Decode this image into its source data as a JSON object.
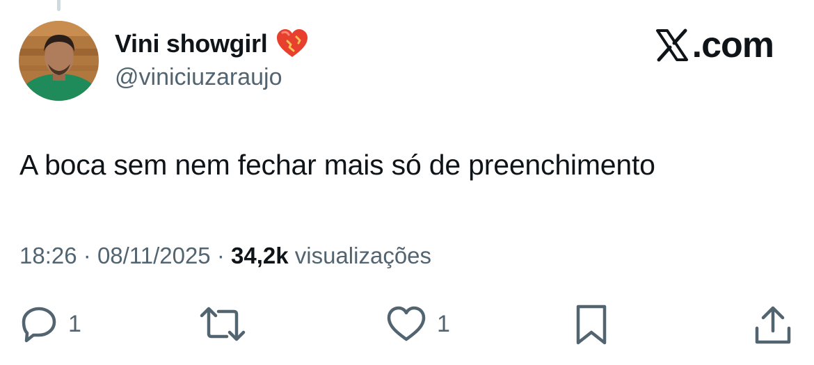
{
  "author": {
    "display_name": "Vini showgirl",
    "handle": "@viniciuzaraujo",
    "badge_icon": "mending-heart-emoji-icon"
  },
  "brand": {
    "text": ".com",
    "logo_icon": "x-logo-icon"
  },
  "tweet": {
    "text": "A boca sem nem fechar mais só de preenchimento"
  },
  "meta": {
    "time": "18:26",
    "separator": "·",
    "date": "08/11/2025",
    "views_count": "34,2k",
    "views_label": "visualizações"
  },
  "actions": {
    "reply_count": "1",
    "like_count": "1",
    "icons": [
      "reply-icon",
      "repost-icon",
      "like-icon",
      "bookmark-icon",
      "share-icon"
    ]
  },
  "colors": {
    "text_primary": "#0f1419",
    "text_secondary": "#536471",
    "thread_line": "#cfd9de"
  }
}
